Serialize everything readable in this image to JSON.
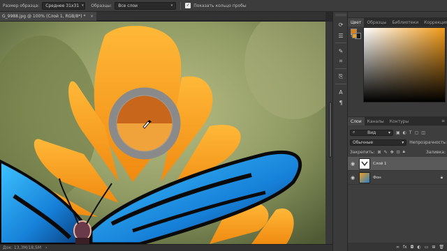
{
  "options_bar": {
    "sample_size_label": "Размер образца:",
    "sample_size_value": "Среднее 31x31",
    "sample_label": "Образцы:",
    "sample_value": "Все слои",
    "show_ring_label": "Показать кольцо пробы",
    "show_ring_checked": true
  },
  "document": {
    "tab_title": "G_9988.jpg @ 100% (Слой 1, RGB/8*) *",
    "close_glyph": "×"
  },
  "sampler_ring": {
    "current_color": "#c8661b",
    "previous_color": "#f0a33a"
  },
  "status": {
    "doc_size": "Док: 13,3M/18,5M",
    "arrow": "›"
  },
  "panel_tabs_top": [
    "Цвет",
    "Образцы",
    "Библиотеки",
    "Коррекция"
  ],
  "color_panel": {
    "foreground_color": "#d9831d",
    "background_color": "#1a1a1a",
    "gamut_warning": "!"
  },
  "layers_tabs": [
    "Слои",
    "Каналы",
    "Контуры"
  ],
  "layers_panel": {
    "filter_label": "Вид",
    "blend_mode": "Обычные",
    "opacity_label": "Непрозрачность:",
    "lock_label": "Закрепить:",
    "fill_label": "Заливка:",
    "layers": [
      {
        "name": "Слой 1",
        "selected": true
      },
      {
        "name": "Фон",
        "selected": false
      }
    ]
  },
  "colors": {
    "panel_bg": "#3a3a3a",
    "accent": "#f29a17"
  }
}
